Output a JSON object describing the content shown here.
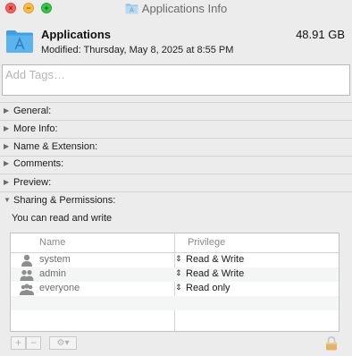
{
  "window": {
    "title": "Applications Info",
    "controls": {
      "close_glyph": "×",
      "minimize_glyph": "−",
      "zoom_glyph": "+"
    }
  },
  "file": {
    "name": "Applications",
    "modified": "Modified: Thursday, May 8, 2025 at 8:55 PM",
    "size": "48.91 GB",
    "icon": "applications-folder-icon"
  },
  "tags": {
    "placeholder": "Add Tags…",
    "value": ""
  },
  "sections": [
    {
      "label": "General:",
      "expanded": false
    },
    {
      "label": "More Info:",
      "expanded": false
    },
    {
      "label": "Name & Extension:",
      "expanded": false
    },
    {
      "label": "Comments:",
      "expanded": false
    },
    {
      "label": "Preview:",
      "expanded": false
    },
    {
      "label": "Sharing & Permissions:",
      "expanded": true
    }
  ],
  "permissions": {
    "summary": "You can read and write",
    "columns": {
      "name": "Name",
      "privilege": "Privilege"
    },
    "rows": [
      {
        "name": "system",
        "privilege": "Read & Write",
        "icon": "single-user-icon"
      },
      {
        "name": "admin",
        "privilege": "Read & Write",
        "icon": "user-group-icon"
      },
      {
        "name": "everyone",
        "privilege": "Read only",
        "icon": "everyone-group-icon"
      }
    ],
    "updown_glyph": "⇕"
  },
  "toolbar": {
    "add_glyph": "+",
    "remove_glyph": "−",
    "action_glyph": "⚙▾",
    "lock_icon": "lock-icon"
  },
  "colors": {
    "window_bg": "#ececec",
    "close": "#fc615d",
    "minimize": "#fdbc40",
    "zoom": "#34c84a",
    "folder_blue": "#5bb4ee",
    "lock_gold": "#e2b46a"
  }
}
